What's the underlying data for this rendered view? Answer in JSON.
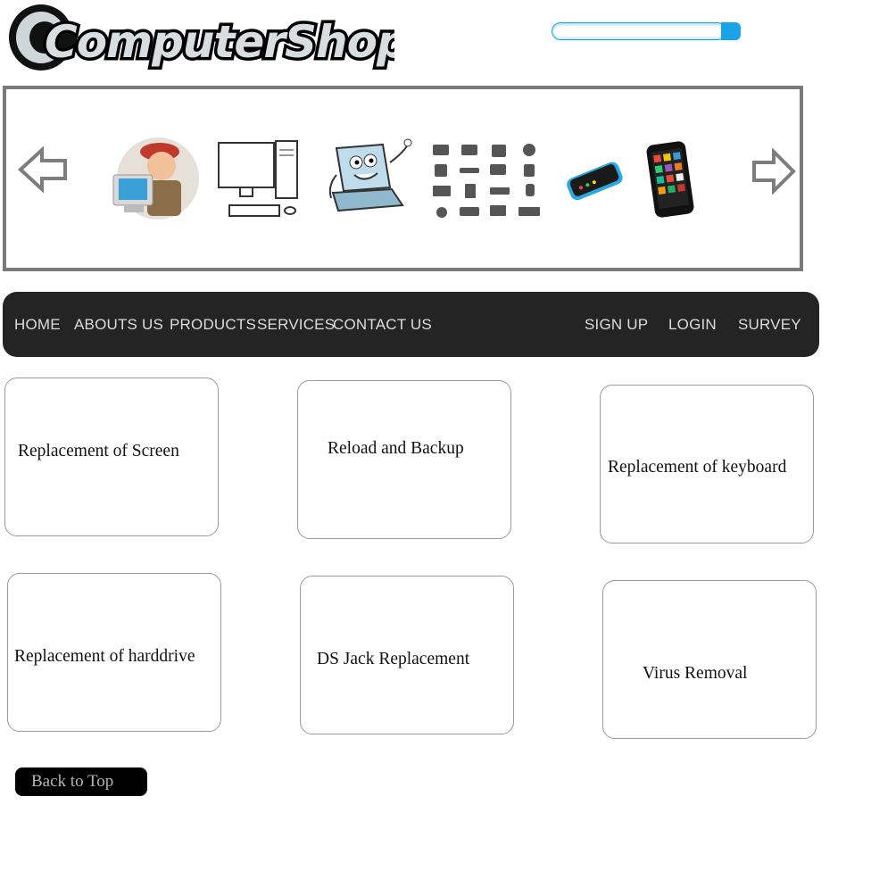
{
  "header": {
    "logo_text": "ComputerShop",
    "search": {
      "placeholder": ""
    }
  },
  "carousel": {
    "prev_icon": "arrow-left-outline-icon",
    "next_icon": "arrow-right-outline-icon",
    "thumbnails": [
      "technician",
      "desktop-computer",
      "laptop-cartoon",
      "hardware-icons-grid",
      "smartphone",
      "tablet-phone"
    ]
  },
  "nav": {
    "left": [
      "HOME",
      "ABOUTS US",
      "PRODUCTS",
      "SERVICES",
      "CONTACT US"
    ],
    "right": [
      "SIGN UP",
      "LOGIN",
      "SURVEY"
    ]
  },
  "services": [
    "Replacement  of Screen",
    "Reload and Backup",
    "Replacement of keyboard",
    "Replacement of harddrive",
    "DS Jack Replacement",
    "Virus Removal"
  ],
  "footer": {
    "back_to_top": "Back to Top"
  },
  "colors": {
    "nav_bg": "#242424",
    "accent": "#1aa3e8",
    "border": "#7a7a7a"
  }
}
